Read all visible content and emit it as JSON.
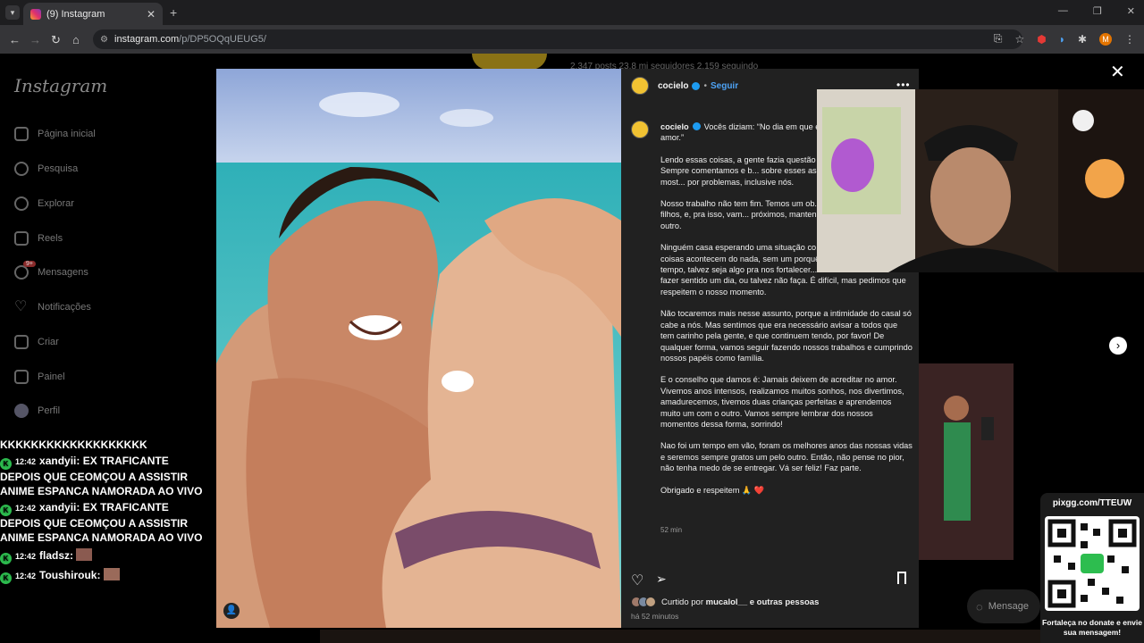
{
  "browser": {
    "tab_title": "(9) Instagram",
    "tab_close": "✕",
    "new_tab": "+",
    "url_host": "instagram.com",
    "url_path": "/p/DP5OQqUEUG5/",
    "profile_initial": "M"
  },
  "background_profile": {
    "stats": "2.347 posts   23,8 mi seguidores   2.159 seguindo"
  },
  "sidebar": {
    "logo": "Instagram",
    "items": [
      {
        "label": "Página inicial",
        "icon": "home-icon"
      },
      {
        "label": "Pesquisa",
        "icon": "search-icon"
      },
      {
        "label": "Explorar",
        "icon": "compass-icon"
      },
      {
        "label": "Reels",
        "icon": "reels-icon"
      },
      {
        "label": "Mensagens",
        "icon": "messenger-icon"
      },
      {
        "label": "Notificações",
        "icon": "heart-icon"
      },
      {
        "label": "Criar",
        "icon": "plus-icon"
      },
      {
        "label": "Painel",
        "icon": "dashboard-icon"
      },
      {
        "label": "Perfil",
        "icon": "profile-icon"
      }
    ],
    "messages_badge": "9+"
  },
  "post": {
    "username": "cocielo",
    "follow_label": "Seguir",
    "more_label": "•••",
    "caption_paragraphs": [
      "Vocês diziam: “No dia em que el... acredito mais no amor.”",
      "Lendo essas coisas, a gente fazia questão d... relacionamentos. Sempre comentamos e b... sobre esses assuntos exatamente pra most... por problemas, inclusive nós.",
      "Nosso trabalho não tem fim. Temos um ob... é cuidar dos nossos filhos, e, pra isso, vam... próximos, mantendo o respeito, a admiraç... outro.",
      "Ninguém casa esperando uma situação co... mas, às vezes, as coisas acontecem do nada, sem um porquê. Talvez seja só um tempo, talvez seja algo pra nos fortalecer... não sabemos. Pode fazer sentido um dia, ou talvez não faça. É difícil, mas pedimos que respeitem o nosso momento.",
      "Não tocaremos mais nesse assunto, porque a intimidade do casal só cabe a nós. Mas sentimos que era necessário avisar a todos que tem carinho pela gente, e que continuem tendo, por favor! De qualquer forma, vamos seguir fazendo nossos trabalhos e cumprindo nossos papéis como família.",
      "E o conselho que damos é: Jamais deixem de acreditar no amor. Vivemos anos intensos, realizamos muitos sonhos, nos divertimos, amadurecemos, tivemos duas crianças perfeitas e aprendemos muito um com o outro. Vamos sempre lembrar dos nossos momentos dessa forma, sorrindo!",
      "Nao foi um tempo em vão, foram os melhores anos das nossas vidas e seremos sempre gratos um pelo outro. Então, não pense no pior, não tenha medo de se entregar. Vá ser feliz! Faz parte.",
      "Obrigado e respeitem 🙏 ❤️"
    ],
    "caption_time": "52 min",
    "liked_prefix": "Curtido por",
    "liked_user": "mucalol__",
    "liked_suffix": "e outras pessoas",
    "posted_ago": "há 52 minutos"
  },
  "chat": [
    {
      "user": "",
      "time": "",
      "text": "KKKKKKKKKKKKKKKKKKK"
    },
    {
      "user": "xandyii:",
      "time": "12:42",
      "text": "EX TRAFICANTE DEPOIS QUE CEOMÇOU A ASSISTIR ANIME ESPANCA NAMORADA AO VIVO"
    },
    {
      "user": "xandyii:",
      "time": "12:42",
      "text": "EX TRAFICANTE DEPOIS QUE CEOMÇOU A ASSISTIR ANIME ESPANCA NAMORADA AO VIVO"
    },
    {
      "user": "fladsz:",
      "time": "12:42",
      "text": ""
    },
    {
      "user": "Toushirouk:",
      "time": "12:42",
      "text": ""
    }
  ],
  "chat_badge": "K",
  "qr_overlay": {
    "url": "pixgg.com/TTEUW",
    "message": "Fortaleça no donate e envie sua mensagem!"
  },
  "message_button": "Mensage",
  "colors": {
    "accent_blue": "#4ea3f5",
    "verified": "#1d9bf0",
    "chat_badge": "#2dbd4f",
    "heart": "#e0245e"
  }
}
